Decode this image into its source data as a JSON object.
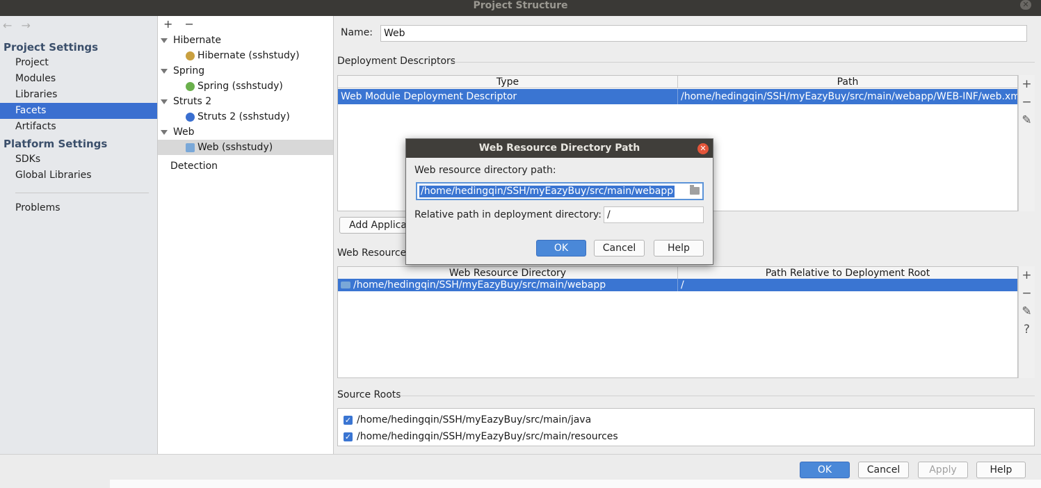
{
  "window": {
    "title": "Project Structure"
  },
  "nav": {
    "back": "←",
    "forward": "→",
    "project_settings": "Project Settings",
    "items_project": [
      "Project",
      "Modules",
      "Libraries",
      "Facets",
      "Artifacts"
    ],
    "platform_settings": "Platform Settings",
    "items_platform": [
      "SDKs",
      "Global Libraries"
    ],
    "problems": "Problems",
    "selected": "Facets"
  },
  "tree": {
    "add": "+",
    "remove": "−",
    "groups": [
      {
        "label": "Hibernate",
        "child": "Hibernate (sshstudy)"
      },
      {
        "label": "Spring",
        "child": "Spring (sshstudy)"
      },
      {
        "label": "Struts 2",
        "child": "Struts 2 (sshstudy)"
      },
      {
        "label": "Web",
        "child": "Web (sshstudy)"
      }
    ],
    "detection": "Detection"
  },
  "facet": {
    "name_label": "Name:",
    "name_value": "Web",
    "deployment_descriptors": "Deployment Descriptors",
    "dd_columns": [
      "Type",
      "Path"
    ],
    "dd_row": [
      "Web Module Deployment Descriptor",
      "/home/hedingqin/SSH/myEazyBuy/src/main/webapp/WEB-INF/web.xm"
    ],
    "add_app_button": "Add Applica",
    "web_resource_label": "Web Resource D",
    "wr_columns": [
      "Web Resource Directory",
      "Path Relative to Deployment Root"
    ],
    "wr_row": [
      "/home/hedingqin/SSH/myEazyBuy/src/main/webapp",
      "/"
    ],
    "source_roots": "Source Roots",
    "source_items": [
      "/home/hedingqin/SSH/myEazyBuy/src/main/java",
      "/home/hedingqin/SSH/myEazyBuy/src/main/resources"
    ]
  },
  "toolbar_icons": {
    "add": "+",
    "remove": "−",
    "edit": "✎",
    "help": "?"
  },
  "footer": {
    "ok": "OK",
    "cancel": "Cancel",
    "apply": "Apply",
    "help": "Help"
  },
  "dialog": {
    "title": "Web Resource Directory Path",
    "path_label": "Web resource directory path:",
    "path_value": "/home/hedingqin/SSH/myEazyBuy/src/main/webapp",
    "relative_label": "Relative path in deployment directory:",
    "relative_value": "/",
    "ok": "OK",
    "cancel": "Cancel",
    "help": "Help"
  },
  "colors": {
    "selection": "#3a75d2",
    "title_bar": "#3a3936",
    "accent_button": "#4a88d8"
  }
}
